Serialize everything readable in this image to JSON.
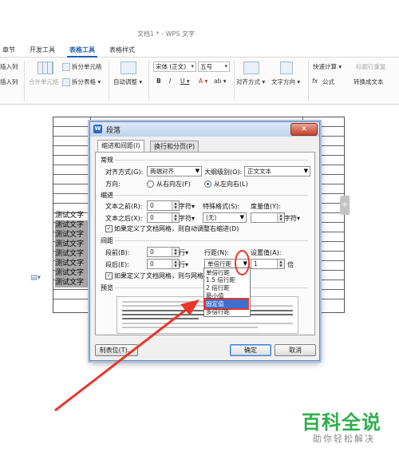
{
  "window": {
    "title": "文档1 * - WPS 文字"
  },
  "tabs": [
    {
      "label": "章节",
      "active": false
    },
    {
      "label": "开发工具",
      "active": false
    },
    {
      "label": "表格工具",
      "active": true
    },
    {
      "label": "表格样式",
      "active": false
    }
  ],
  "ribbon": {
    "insert_col_1": "插入列",
    "insert_col_2": "插入列",
    "merge_cells": "合并单元格",
    "split_cells": "拆分单元格",
    "split_table": "拆分表格 ▾",
    "autofit": "自动调整 ▾",
    "font_name": "宋体 (正文)",
    "font_size": "五号",
    "bold": "B",
    "italic": "I",
    "underline": "U ▾",
    "font_color": "A ▾",
    "highlight": "ab ▾",
    "align": "对齐方式 ▾",
    "text_direction": "文字方向 ▾",
    "quick_calc": "快速计算 ▾",
    "title_repeat": "标题行重复",
    "formula": "公式",
    "convert_text": "转换成文本",
    "fx": "fx"
  },
  "document": {
    "cells": [
      "测试文字",
      "测试文字",
      "测试文字",
      "测试文字",
      "测试文字",
      "测试文字",
      "测试文字",
      "测试文字"
    ],
    "side_tab": "+"
  },
  "dialog": {
    "icon": "W",
    "title": "段落",
    "close": "✕",
    "tabs": [
      "缩进和间距(I)",
      "换行和分页(P)"
    ],
    "general": {
      "section": "常规",
      "align_label": "对齐方式(G):",
      "align_value": "两端对齐",
      "outline_label": "大纲级别(O):",
      "outline_value": "正文文本",
      "direction_label": "方向:",
      "rtl": "从右向左(F)",
      "ltr": "从左向右(L)"
    },
    "indent": {
      "section": "缩进",
      "before_label": "文本之前(R):",
      "before_value": "0",
      "before_unit": "字符▾",
      "after_label": "文本之后(X):",
      "after_value": "0",
      "after_unit": "字符▾",
      "special_label": "特殊格式(S):",
      "special_value": "(无)",
      "measure_label": "度量值(Y):",
      "measure_value": "",
      "measure_unit": "字符▾",
      "grid_check": "如果定义了文档网格，则自动调整右缩进(D)"
    },
    "spacing": {
      "section": "间距",
      "before_label": "段前(B):",
      "before_value": "0",
      "before_unit": "行▾",
      "after_label": "段后(E):",
      "after_value": "0",
      "after_unit": "行▾",
      "line_label": "行距(N):",
      "line_value": "单倍行距",
      "setval_label": "设置值(A):",
      "setval_value": "1",
      "setval_unit": "倍",
      "grid_check": "如果定义了文档网格，则与网格对齐"
    },
    "preview_label": "预览",
    "buttons": {
      "tabs": "制表位(T)...",
      "ok": "确定",
      "cancel": "取消"
    }
  },
  "line_spacing_dropdown": {
    "options": [
      "单倍行距",
      "1.5 倍行距",
      "2 倍行距",
      "最小值",
      "固定值",
      "多倍行距"
    ],
    "highlighted_index": 4
  },
  "watermark": {
    "main": "百科全说",
    "sub": "助你轻松解决"
  },
  "colors": {
    "accent": "#1b5fb5",
    "highlight": "#3c6fce",
    "annotation": "#e8362c",
    "watermark": "#2fae4d"
  }
}
